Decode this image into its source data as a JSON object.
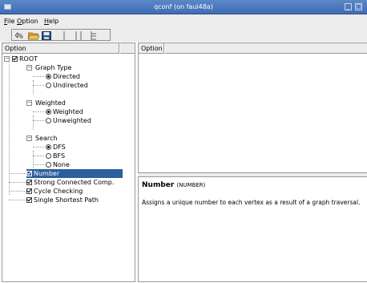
{
  "window": {
    "title": "qconf (on faui48a)"
  },
  "menubar": {
    "items": [
      {
        "accel": "F",
        "rest": "ile"
      },
      {
        "accel": "O",
        "rest": "ption"
      },
      {
        "accel": "H",
        "rest": "elp"
      }
    ]
  },
  "toolbar": {
    "buttons": [
      "back-icon",
      "open-folder-icon",
      "save-icon",
      "single-view-icon",
      "split-view-icon",
      "full-view-icon"
    ]
  },
  "left_pane": {
    "header": "Option"
  },
  "right_pane": {
    "header": "Option"
  },
  "tree": [
    {
      "label": "ROOT",
      "type": "checkbox",
      "checked": true,
      "expandable": true
    },
    {
      "label": "Graph Type",
      "type": "group",
      "expandable": true
    },
    {
      "label": "Directed",
      "type": "radio",
      "selected": true
    },
    {
      "label": "Undirected",
      "type": "radio",
      "selected": false
    },
    {
      "label": "Weighted",
      "type": "group",
      "expandable": true
    },
    {
      "label": "Weighted",
      "type": "radio",
      "selected": true
    },
    {
      "label": "Unweighted",
      "type": "radio",
      "selected": false
    },
    {
      "label": "Search",
      "type": "group",
      "expandable": true
    },
    {
      "label": "DFS",
      "type": "radio",
      "selected": true
    },
    {
      "label": "BFS",
      "type": "radio",
      "selected": false
    },
    {
      "label": "None",
      "type": "radio",
      "selected": false
    },
    {
      "label": "Number",
      "type": "checkbox",
      "checked": true,
      "highlighted": true
    },
    {
      "label": "Strong Connected Comp.",
      "type": "checkbox",
      "checked": true
    },
    {
      "label": "Cycle Checking",
      "type": "checkbox",
      "checked": true
    },
    {
      "label": "Single Shortest Path",
      "type": "checkbox",
      "checked": true
    }
  ],
  "help": {
    "title": "Number",
    "symbol": "(NUMBER)",
    "text": "Assigns a unique number to each vertex as a result of a graph traversal."
  },
  "colors": {
    "titlebar": "#4a78bd",
    "selection": "#2b5e9d",
    "chrome": "#ececec"
  }
}
